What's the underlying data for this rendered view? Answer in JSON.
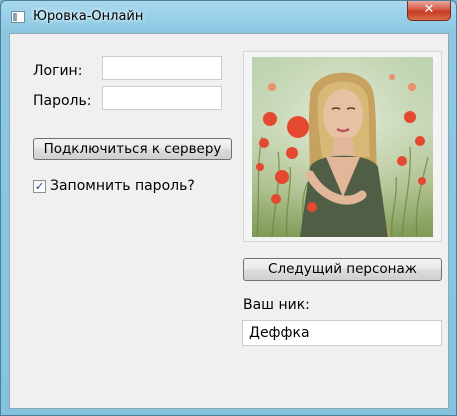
{
  "window": {
    "title": "Юровка-Онлайн",
    "close_glyph": "✕"
  },
  "form": {
    "login_label": "Логин:",
    "login_value": "",
    "password_label": "Пароль:",
    "password_value": "",
    "connect_button": "Подключиться к серверу",
    "remember_label": "Запомнить пароль?",
    "remember_checked": true,
    "check_glyph": "✓"
  },
  "character": {
    "photo_icon": "portrait-photo",
    "next_button": "Следущий персонаж",
    "nick_label": "Ваш ник:",
    "nick_value": "Деффка"
  }
}
